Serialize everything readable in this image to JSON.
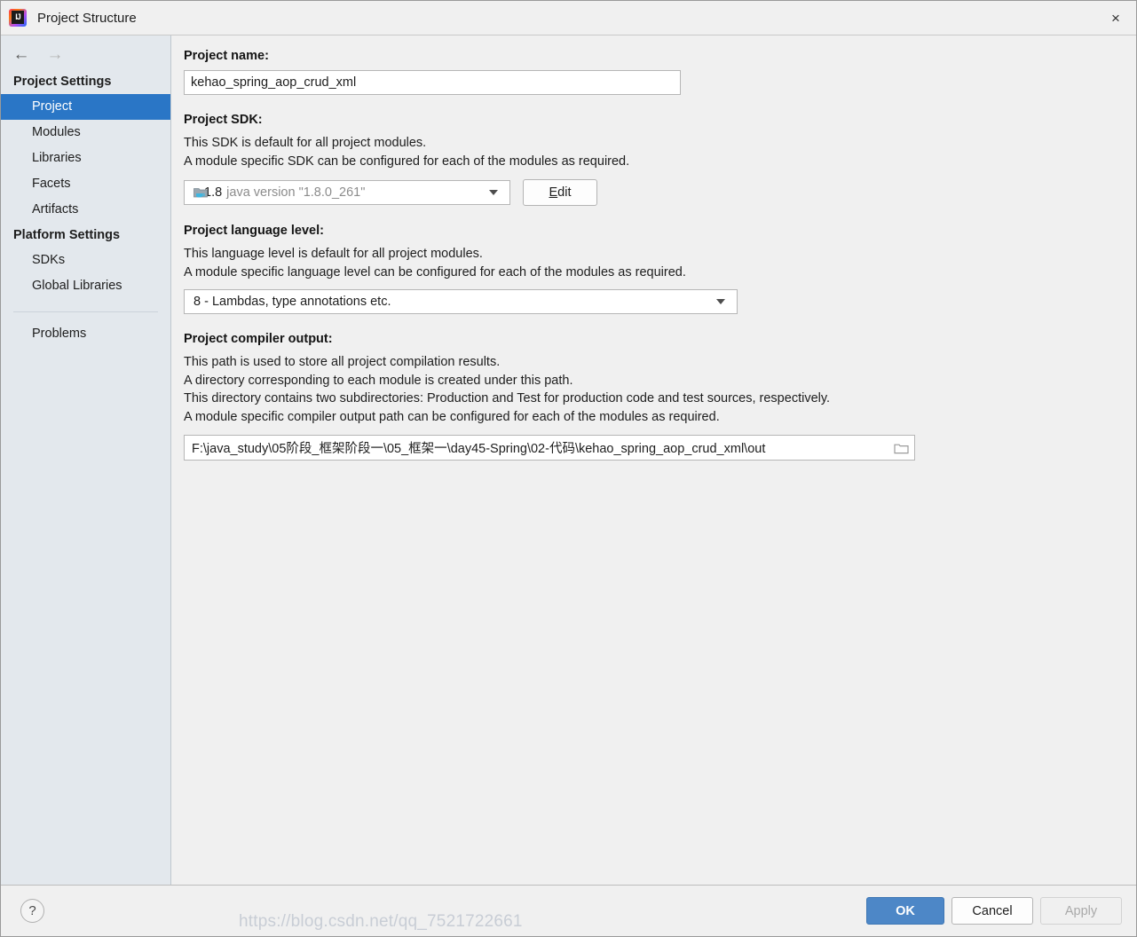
{
  "window": {
    "title": "Project Structure",
    "app_icon": "intellij-idea-icon",
    "close_icon": "×"
  },
  "nav": {
    "back_icon": "←",
    "forward_icon": "→"
  },
  "sidebar": {
    "groups": [
      {
        "title": "Project Settings",
        "items": [
          {
            "label": "Project",
            "selected": true
          },
          {
            "label": "Modules",
            "selected": false
          },
          {
            "label": "Libraries",
            "selected": false
          },
          {
            "label": "Facets",
            "selected": false
          },
          {
            "label": "Artifacts",
            "selected": false
          }
        ]
      },
      {
        "title": "Platform Settings",
        "items": [
          {
            "label": "SDKs",
            "selected": false
          },
          {
            "label": "Global Libraries",
            "selected": false
          }
        ]
      }
    ],
    "problems_label": "Problems"
  },
  "main": {
    "project_name": {
      "label": "Project name:",
      "value": "kehao_spring_aop_crud_xml"
    },
    "project_sdk": {
      "label": "Project SDK:",
      "desc_lines": [
        "This SDK is default for all project modules.",
        "A module specific SDK can be configured for each of the modules as required."
      ],
      "selected_version": "1.8",
      "selected_desc": "java version \"1.8.0_261\"",
      "edit_button": "Edit",
      "edit_mnemonic": "E",
      "edit_rest": "dit"
    },
    "language_level": {
      "label": "Project language level:",
      "desc_lines": [
        "This language level is default for all project modules.",
        "A module specific language level can be configured for each of the modules as required."
      ],
      "selected": "8 - Lambdas, type annotations etc."
    },
    "compiler_output": {
      "label": "Project compiler output:",
      "desc_lines": [
        "This path is used to store all project compilation results.",
        "A directory corresponding to each module is created under this path.",
        "This directory contains two subdirectories: Production and Test for production code and test sources, respectively.",
        "A module specific compiler output path can be configured for each of the modules as required."
      ],
      "path": "F:\\java_study\\05阶段_框架阶段一\\05_框架一\\day45-Spring\\02-代码\\kehao_spring_aop_crud_xml\\out",
      "browse_icon": "folder-icon"
    }
  },
  "footer": {
    "help_label": "?",
    "ok_label": "OK",
    "cancel_label": "Cancel",
    "apply_label": "Apply",
    "watermark": "https://blog.csdn.net/qq_7521722661"
  },
  "colors": {
    "accent": "#2a76c6",
    "primary_button": "#4d87c7",
    "sidebar_bg": "#e3e8ed",
    "content_bg": "#f0f0f0"
  }
}
